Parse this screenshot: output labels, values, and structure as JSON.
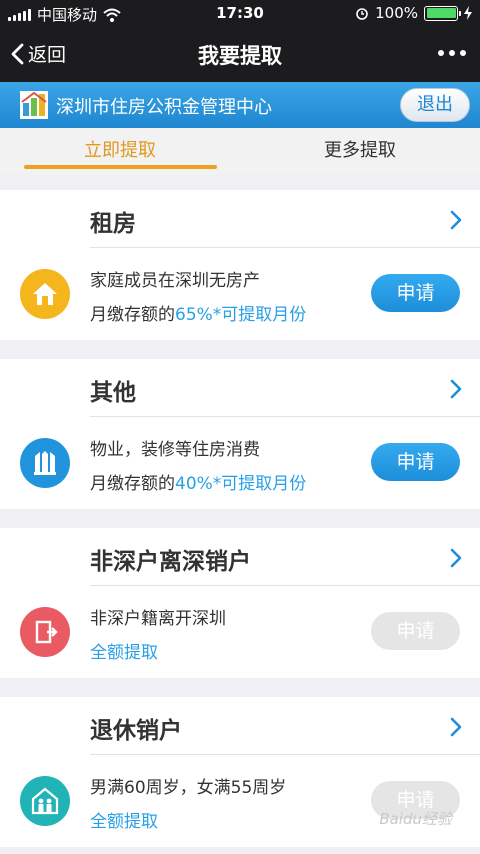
{
  "status": {
    "carrier": "中国移动",
    "time": "17:30",
    "battery": "100%"
  },
  "nav": {
    "back": "返回",
    "title": "我要提取"
  },
  "banner": {
    "org": "深圳市住房公积金管理中心",
    "logout": "退出"
  },
  "tabs": [
    {
      "label": "立即提取"
    },
    {
      "label": "更多提取"
    }
  ],
  "cards": [
    {
      "title": "租房",
      "desc": "家庭成员在深圳无房产",
      "sub_prefix": "月缴存额的",
      "sub_highlight": "65%*可提取月份",
      "apply": "申请",
      "icon": "house-icon",
      "color": "#f4b51d"
    },
    {
      "title": "其他",
      "desc": "物业，装修等住房消费",
      "sub_prefix": "月缴存额的",
      "sub_highlight": "40%*可提取月份",
      "apply": "申请",
      "icon": "building-icon",
      "color": "#2294de"
    },
    {
      "title": "非深户离深销户",
      "desc": "非深户籍离开深圳",
      "sub_prefix": "",
      "sub_highlight": "全额提取",
      "apply": "申请",
      "icon": "exit-door-icon",
      "color": "#e95a63"
    },
    {
      "title": "退休销户",
      "desc": "男满60周岁，女满55周岁",
      "sub_prefix": "",
      "sub_highlight": "全额提取",
      "apply": "申请",
      "icon": "family-home-icon",
      "color": "#22b3b7"
    }
  ],
  "watermark": "Baidu经验"
}
